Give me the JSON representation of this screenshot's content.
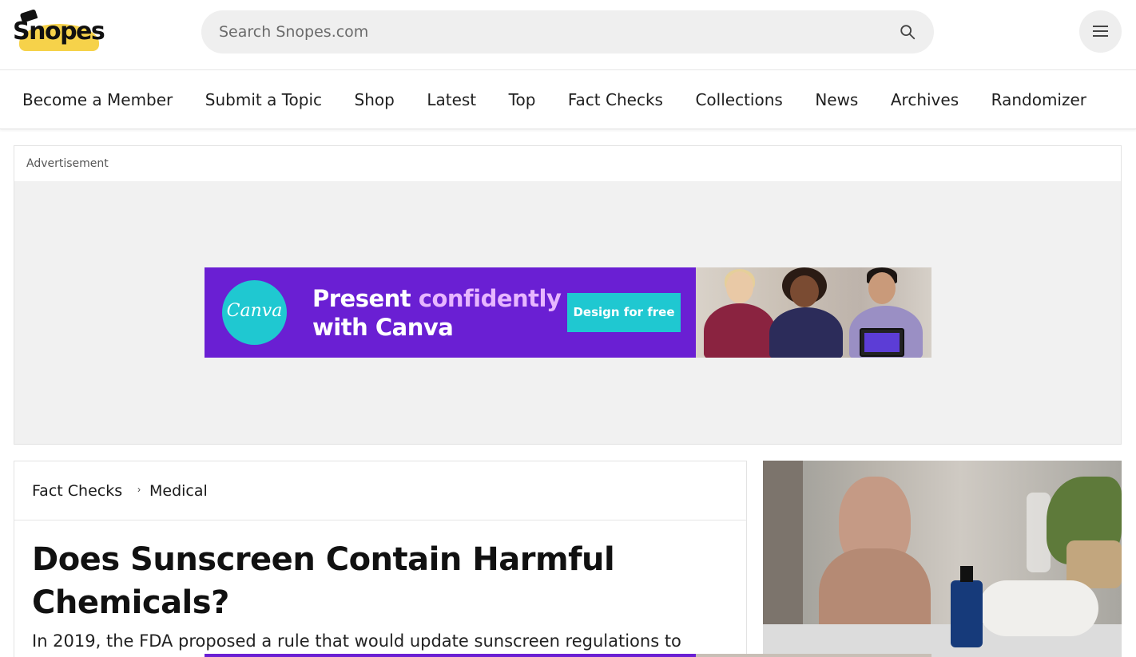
{
  "header": {
    "logo_text": "Snopes",
    "search_placeholder": "Search Snopes.com"
  },
  "nav": {
    "items": [
      "Become a Member",
      "Submit a Topic",
      "Shop",
      "Latest",
      "Top",
      "Fact Checks",
      "Collections",
      "News",
      "Archives",
      "Randomizer"
    ]
  },
  "ad": {
    "label": "Advertisement",
    "logo_text": "Canva",
    "headline_part1": "Present",
    "headline_highlight": "confidently",
    "headline_part2": "with Canva",
    "cta": "Design for free"
  },
  "article": {
    "breadcrumb": [
      "Fact Checks",
      "Medical"
    ],
    "title": "Does Sunscreen Contain Harmful Chemicals?",
    "summary": "In 2019, the FDA proposed a rule that would update sunscreen regulations to"
  },
  "colors": {
    "brand_yellow": "#f6d24a",
    "canva_purple": "#6a1fd3",
    "canva_teal": "#1fc8d1"
  }
}
